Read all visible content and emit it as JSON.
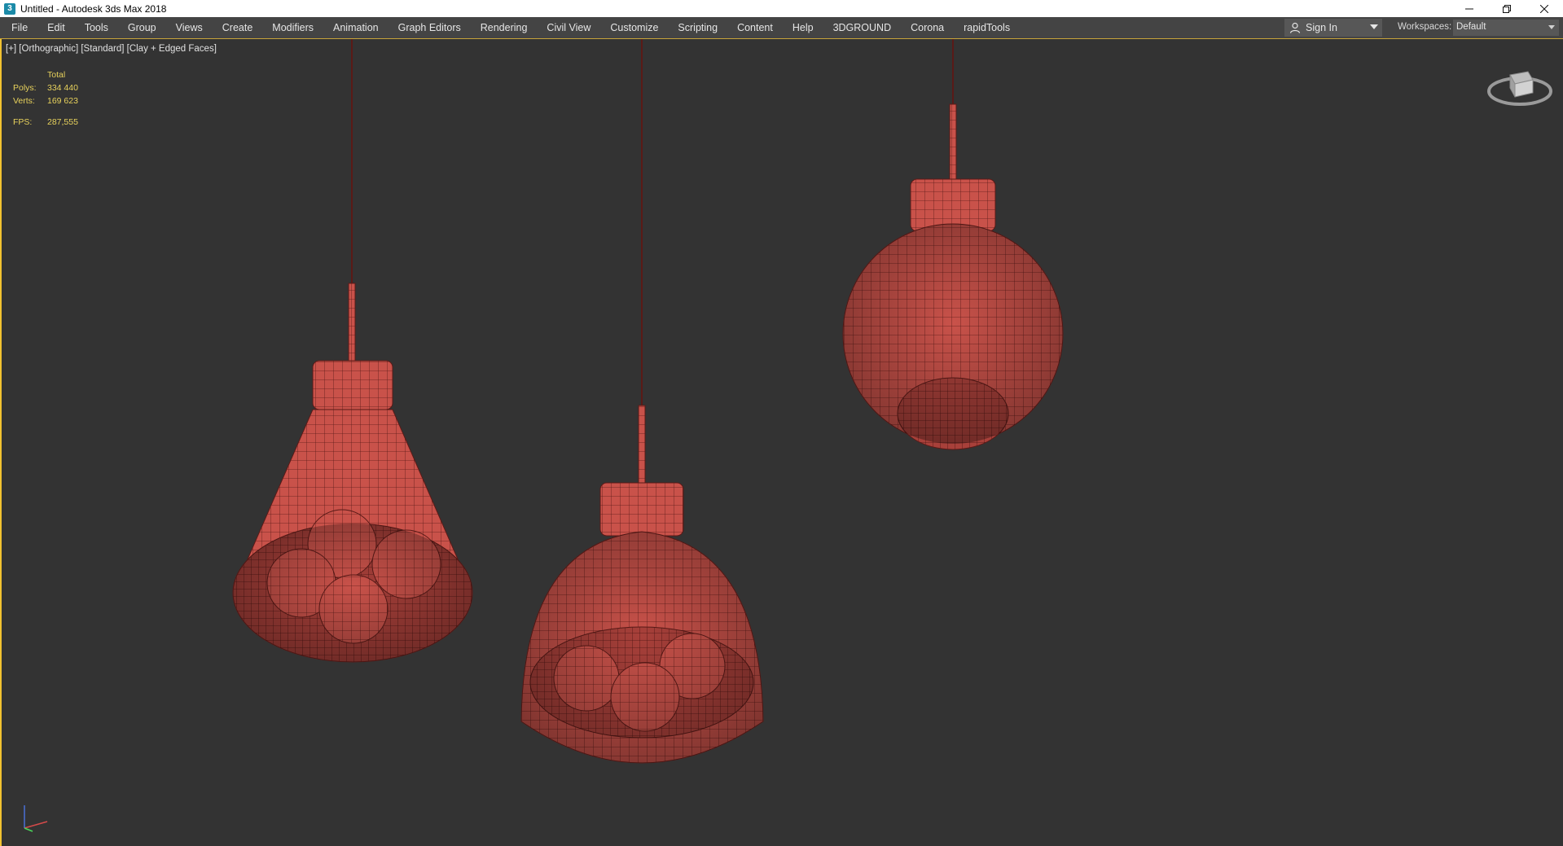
{
  "window": {
    "title": "Untitled - Autodesk 3ds Max 2018",
    "app_icon": "3ds-max-icon",
    "controls": [
      "minimize-icon",
      "restore-icon",
      "close-icon"
    ]
  },
  "menubar": {
    "items": [
      "File",
      "Edit",
      "Tools",
      "Group",
      "Views",
      "Create",
      "Modifiers",
      "Animation",
      "Graph Editors",
      "Rendering",
      "Civil View",
      "Customize",
      "Scripting",
      "Content",
      "Help",
      "3DGROUND",
      "Corona",
      "rapidTools"
    ],
    "sign_in": "Sign In",
    "workspaces_label": "Workspaces:",
    "workspace_value": "Default"
  },
  "viewport": {
    "label": "[+] [Orthographic] [Standard] [Clay + Edged Faces]",
    "stats": {
      "header": "Total",
      "polys_label": "Polys:",
      "polys_value": "334 440",
      "verts_label": "Verts:",
      "verts_value": "169 623",
      "fps_label": "FPS:",
      "fps_value": "287,555"
    },
    "accent_color": "#f2c230",
    "clay_color": "#c9524a",
    "background": "#333333"
  }
}
